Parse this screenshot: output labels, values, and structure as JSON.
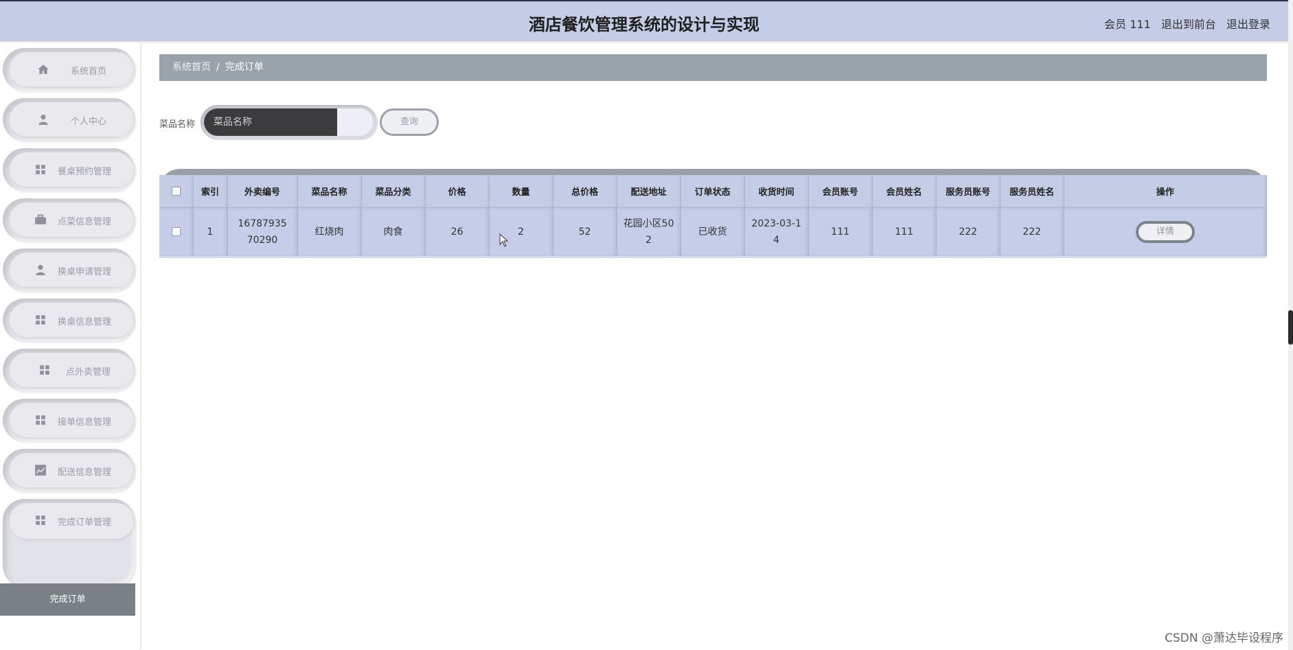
{
  "header": {
    "title": "酒店餐饮管理系统的设计与实现",
    "user_label": "会员 111",
    "to_front": "退出到前台",
    "logout": "退出登录"
  },
  "sidebar": {
    "items": [
      {
        "label": "系统首页",
        "icon": "home-icon"
      },
      {
        "label": "个人中心",
        "icon": "user-icon"
      },
      {
        "label": "餐桌预约管理",
        "icon": "grid-icon"
      },
      {
        "label": "点菜信息管理",
        "icon": "briefcase-icon"
      },
      {
        "label": "换桌申请管理",
        "icon": "user-icon"
      },
      {
        "label": "换桌信息管理",
        "icon": "grid-icon"
      },
      {
        "label": "点外卖管理",
        "icon": "grid-icon"
      },
      {
        "label": "接单信息管理",
        "icon": "grid-icon"
      },
      {
        "label": "配送信息管理",
        "icon": "chart-icon"
      },
      {
        "label": "完成订单管理",
        "icon": "grid-icon"
      }
    ],
    "active_sub": "完成订单"
  },
  "breadcrumb": {
    "home": "系统首页",
    "separator": "/",
    "current": "完成订单"
  },
  "search": {
    "label": "菜品名称",
    "placeholder": "菜品名称",
    "button": "查询"
  },
  "table": {
    "headers": [
      "索引",
      "外卖编号",
      "菜品名称",
      "菜品分类",
      "价格",
      "数量",
      "总价格",
      "配送地址",
      "订单状态",
      "收货时间",
      "会员账号",
      "会员姓名",
      "服务员账号",
      "服务员姓名",
      "操作"
    ],
    "rows": [
      {
        "index": "1",
        "order_no": "1678793570290",
        "dish": "红烧肉",
        "category": "肉食",
        "price": "26",
        "qty": "2",
        "total": "52",
        "address": "花园小区502",
        "status": "已收货",
        "time": "2023-03-14",
        "member_acc": "111",
        "member_name": "111",
        "waiter_acc": "222",
        "waiter_name": "222",
        "action": "详情"
      }
    ]
  },
  "watermark": "CSDN @萧达毕设程序"
}
